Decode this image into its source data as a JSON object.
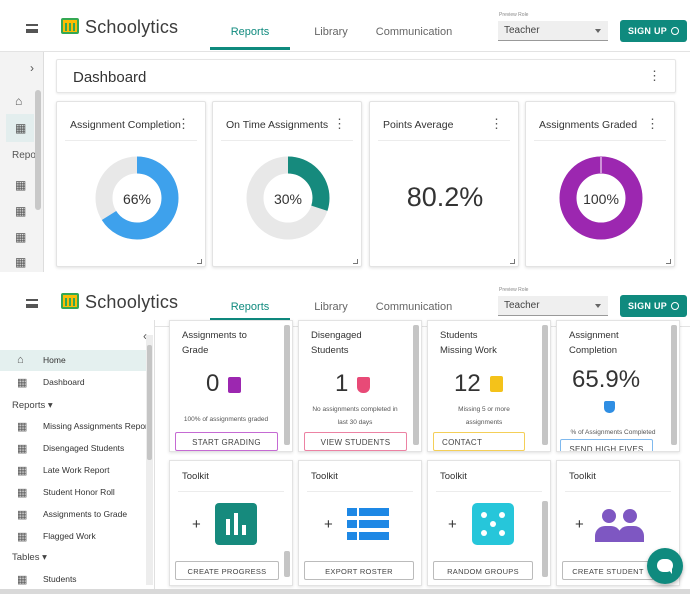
{
  "app": {
    "logo_text": "Schoolytics",
    "tabs": [
      "Reports",
      "Library",
      "Communication"
    ],
    "active_tab": "Reports",
    "preview_label": "Preview Role",
    "preview_value": "Teacher",
    "signup_label": "SIGN UP"
  },
  "top": {
    "rail_chevron": "›",
    "rail_section": "Repo",
    "dashboard_title": "Dashboard",
    "cards": [
      {
        "title": "Assignment Completion",
        "kind": "donut",
        "value": 0.66,
        "label": "66%",
        "color": "#3ea1ec",
        "track": "#e8e8e8"
      },
      {
        "title": "On Time Assignments",
        "kind": "donut",
        "value": 0.3,
        "label": "30%",
        "color": "#168a7d",
        "track": "#e8e8e8"
      },
      {
        "title": "Points Average",
        "kind": "number",
        "label": "80.2%"
      },
      {
        "title": "Assignments Graded",
        "kind": "donut",
        "value": 1.0,
        "label": "100%",
        "color": "#9c27b0",
        "track": "#e8e8e8"
      }
    ]
  },
  "sidebar": {
    "collapse": "‹",
    "items_top": [
      {
        "label": "Home",
        "icon": "home-icon"
      },
      {
        "label": "Dashboard",
        "icon": "dashboard-icon"
      }
    ],
    "reports_header": "Reports ▾",
    "reports": [
      "Missing Assignments Report",
      "Disengaged Students",
      "Late Work Report",
      "Student Honor Roll",
      "Assignments to Grade",
      "Flagged Work"
    ],
    "tables_header": "Tables ▾",
    "tables": [
      "Students"
    ]
  },
  "tiles": [
    {
      "title1": "Assignments to",
      "title2": "Grade",
      "number": "0",
      "icon_color": "#9c27b0",
      "sub1": "100% of assignments graded",
      "sub2": "",
      "button": "START GRADING",
      "btn_color": "#c56ad3"
    },
    {
      "title1": "Disengaged",
      "title2": "Students",
      "number": "1",
      "icon_color": "#e84a77",
      "sub1": "No assignments completed in",
      "sub2": "last 30 days",
      "button": "VIEW STUDENTS",
      "btn_color": "#ec82a3"
    },
    {
      "title1": "Students",
      "title2": "Missing Work",
      "number": "12",
      "icon_color": "#f4c21a",
      "sub1": "Missing 5 or more",
      "sub2": "assignments",
      "button": "CONTACT",
      "btn_color": "#f4cf58"
    },
    {
      "title1": "Assignment",
      "title2": "Completion",
      "number": "65.9%",
      "icon_color": "#2f8ee3",
      "sub1": "% of Assignments Completed",
      "sub2": "",
      "button": "SEND HIGH FIVES",
      "btn_color": "#7fb9ee"
    }
  ],
  "toolkit": [
    {
      "title": "Toolkit",
      "button": "CREATE PROGRESS",
      "icon": "bar-chart-icon",
      "color": "#168a7d"
    },
    {
      "title": "Toolkit",
      "button": "EXPORT ROSTER",
      "icon": "roster-list-icon",
      "color": "#1e88e5"
    },
    {
      "title": "Toolkit",
      "button": "RANDOM GROUPS",
      "icon": "dice-icon",
      "color": "#26c6da"
    },
    {
      "title": "Toolkit",
      "button": "CREATE STUDENT",
      "icon": "people-icon",
      "color": "#7e57c2"
    }
  ]
}
